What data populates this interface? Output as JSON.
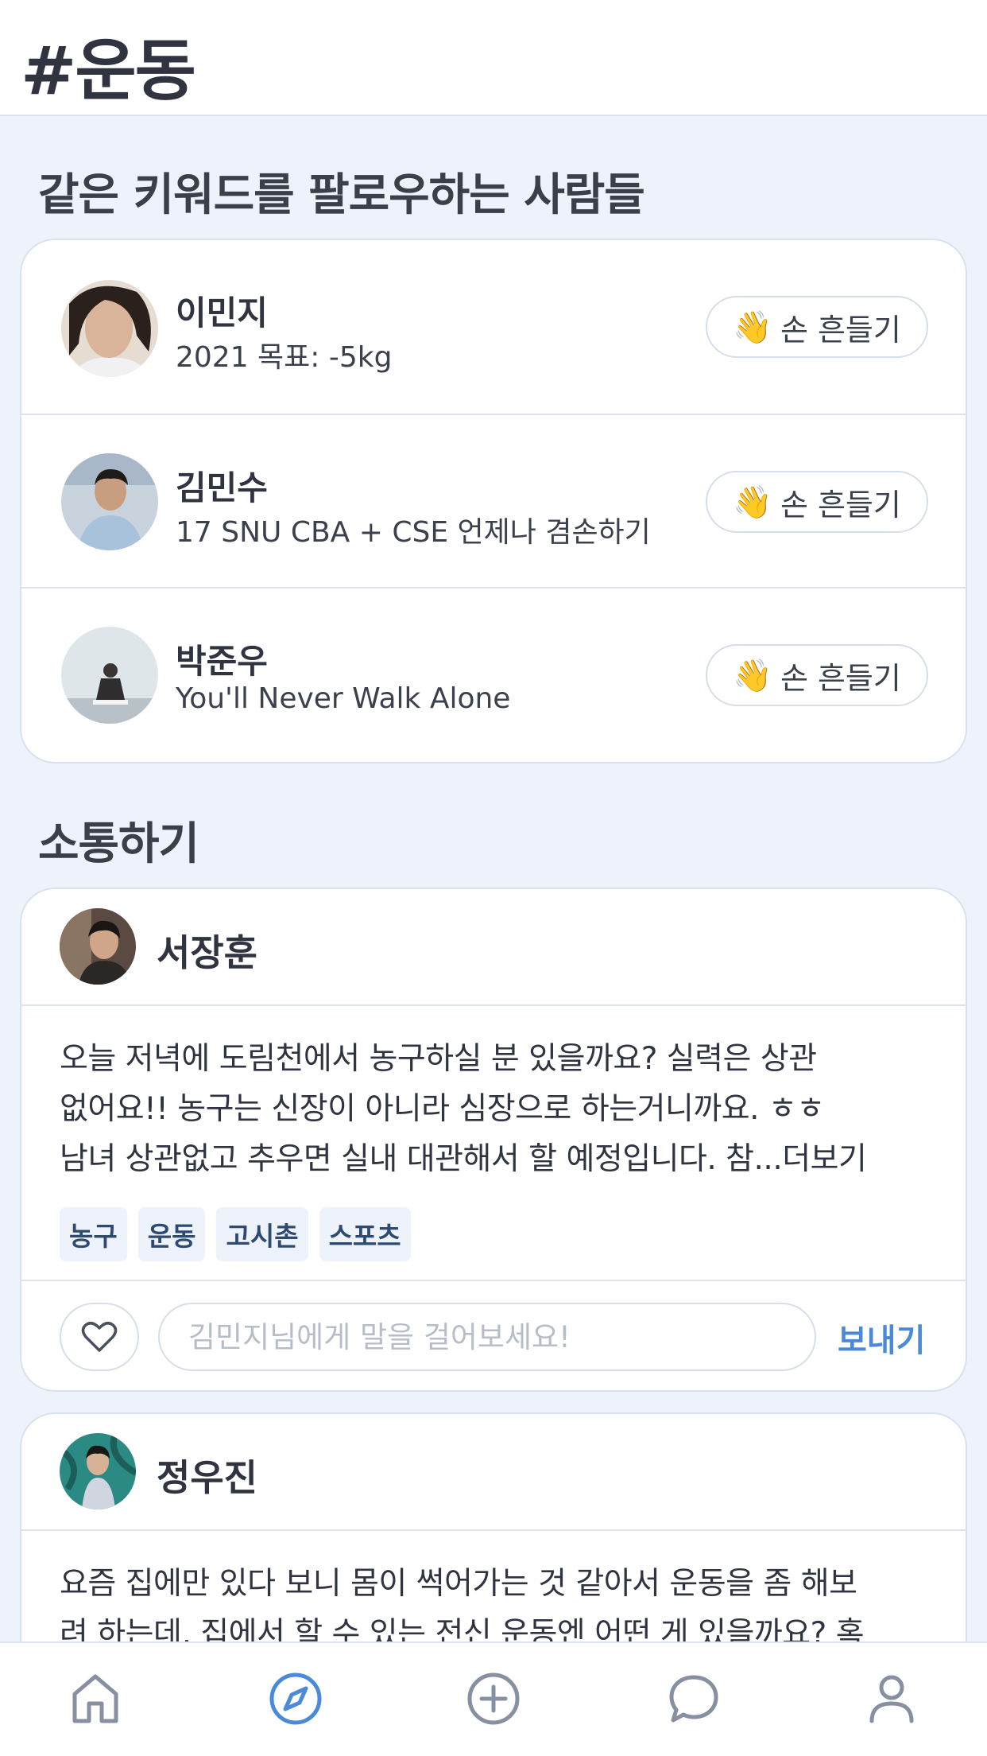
{
  "header": {
    "title": "#운동"
  },
  "followers_section": {
    "title": "같은 키워드를 팔로우하는 사람들",
    "wave_label": "손 흔들기",
    "wave_emoji": "👋",
    "people": [
      {
        "name": "이민지",
        "status": "2021 목표: -5kg"
      },
      {
        "name": "김민수",
        "status": "17 SNU CBA + CSE 언제나 겸손하기"
      },
      {
        "name": "박준우",
        "status": "You'll Never Walk Alone"
      }
    ]
  },
  "community_section": {
    "title": "소통하기",
    "posts": [
      {
        "author": "서장훈",
        "lines": [
          "오늘 저녁에 도림천에서 농구하실 분 있을까요? 실력은 상관",
          "없어요!! 농구는 신장이 아니라 심장으로 하는거니까요. ㅎㅎ",
          "남녀 상관없고 추우면 실내 대관해서 할 예정입니다. 참...더보기"
        ],
        "tags": [
          "농구",
          "운동",
          "고시촌",
          "스포츠"
        ],
        "comment_placeholder": "김민지님에게 말을 걸어보세요!",
        "send_label": "보내기"
      },
      {
        "author": "정우진",
        "lines": [
          "요즘 집에만 있다 보니 몸이 썩어가는 것 같아서 운동을 좀 해보",
          "려 하는데, 집에서 할 수 있는 전신 운동엔 어떤 게 있을까요? 혹"
        ]
      }
    ]
  },
  "bottom_nav": {
    "items": [
      "home-icon",
      "compass-icon",
      "plus-circle-icon",
      "chat-icon",
      "profile-icon"
    ],
    "active_color": "#4a8ad8",
    "inactive_color": "#8790a0"
  }
}
